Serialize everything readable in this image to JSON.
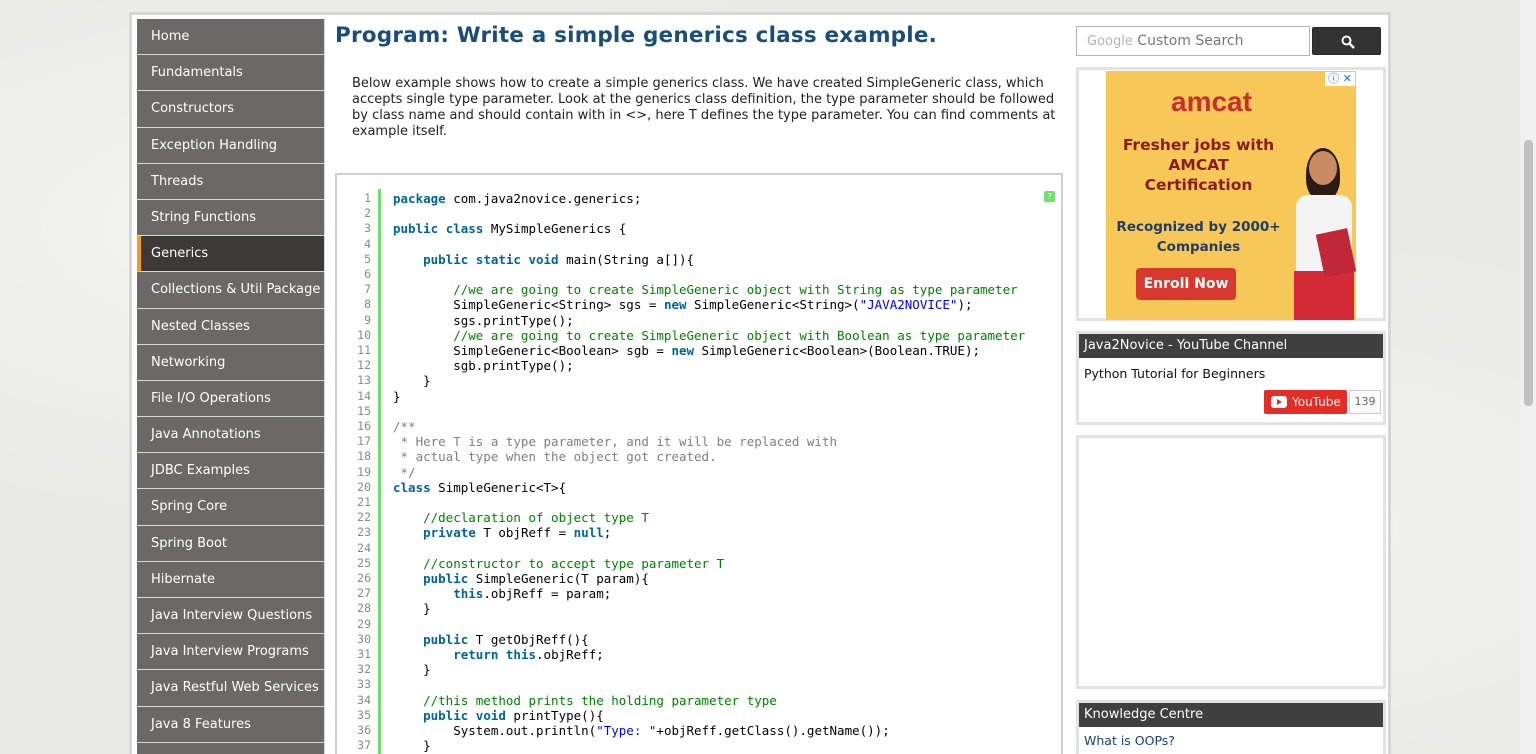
{
  "sidebar": {
    "items": [
      {
        "label": "Home",
        "active": false
      },
      {
        "label": "Fundamentals",
        "active": false
      },
      {
        "label": "Constructors",
        "active": false
      },
      {
        "label": "Exception Handling",
        "active": false
      },
      {
        "label": "Threads",
        "active": false
      },
      {
        "label": "String Functions",
        "active": false
      },
      {
        "label": "Generics",
        "active": true
      },
      {
        "label": "Collections & Util Package",
        "active": false
      },
      {
        "label": "Nested Classes",
        "active": false
      },
      {
        "label": "Networking",
        "active": false
      },
      {
        "label": "File I/O Operations",
        "active": false
      },
      {
        "label": "Java Annotations",
        "active": false
      },
      {
        "label": "JDBC Examples",
        "active": false
      },
      {
        "label": "Spring Core",
        "active": false
      },
      {
        "label": "Spring Boot",
        "active": false
      },
      {
        "label": "Hibernate",
        "active": false
      },
      {
        "label": "Java Interview Questions",
        "active": false
      },
      {
        "label": "Java Interview Programs",
        "active": false
      },
      {
        "label": "Java Restful Web Services",
        "active": false
      },
      {
        "label": "Java 8 Features",
        "active": false
      },
      {
        "label": "",
        "active": false
      }
    ]
  },
  "main": {
    "title": "Program: Write a simple generics class example.",
    "intro": "Below example shows how to create a simple generics class. We have created SimpleGeneric class, which accepts single type parameter. Look at the generics class definition, the type parameter should be followed by class name and should contain with in <>, here T defines the type parameter. You can find comments at example itself.",
    "help_label": "?",
    "code_lines": [
      "package com.java2novice.generics;",
      "",
      "public class MySimpleGenerics {",
      "",
      "    public static void main(String a[]){",
      "",
      "        //we are going to create SimpleGeneric object with String as type parameter",
      "        SimpleGeneric<String> sgs = new SimpleGeneric<String>(\"JAVA2NOVICE\");",
      "        sgs.printType();",
      "        //we are going to create SimpleGeneric object with Boolean as type parameter",
      "        SimpleGeneric<Boolean> sgb = new SimpleGeneric<Boolean>(Boolean.TRUE);",
      "        sgb.printType();",
      "    }",
      "}",
      "",
      "/**",
      " * Here T is a type parameter, and it will be replaced with",
      " * actual type when the object got created.",
      " */",
      "class SimpleGeneric<T>{",
      "",
      "    //declaration of object type T",
      "    private T objReff = null;",
      "",
      "    //constructor to accept type parameter T",
      "    public SimpleGeneric(T param){",
      "        this.objReff = param;",
      "    }",
      "",
      "    public T getObjReff(){",
      "        return this.objReff;",
      "    }",
      "",
      "    //this method prints the holding parameter type",
      "    public void printType(){",
      "        System.out.println(\"Type: \"+objReff.getClass().getName());",
      "    }",
      "}"
    ]
  },
  "search": {
    "brand": "Google",
    "placeholder": "Custom Search",
    "icon": "search-icon"
  },
  "ad": {
    "brand": "amcat",
    "headline": "Fresher jobs with AMCAT Certification",
    "subline": "Recognized by 2000+ Companies",
    "cta": "Enroll Now",
    "close_label": "ⓘ ✕"
  },
  "youtube": {
    "header": "Java2Novice - YouTube Channel",
    "video_title": "Python Tutorial for Beginners",
    "button_label": "YouTube",
    "subscriber_count": "139"
  },
  "knowledge": {
    "header": "Knowledge Centre",
    "link": "What is OOPs?"
  },
  "colors": {
    "title": "#1a4d7a",
    "nav_bg": "#6b6867",
    "nav_active_bg": "#3c3a39",
    "nav_active_accent": "#f59a24",
    "keyword": "#006699",
    "comment": "#008200",
    "string": "#0000ff",
    "gutter": "#6ce26c"
  }
}
